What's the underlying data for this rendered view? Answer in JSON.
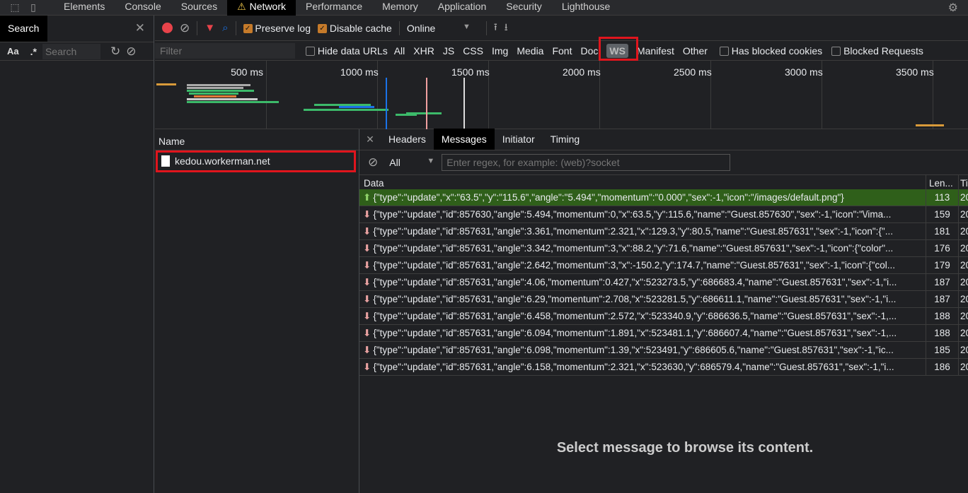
{
  "devtools_tabs": [
    "Elements",
    "Console",
    "Sources",
    "Network",
    "Performance",
    "Memory",
    "Application",
    "Security",
    "Lighthouse"
  ],
  "active_tab": "Network",
  "search_panel": {
    "title": "Search",
    "case_label": "Aa",
    "regex_label": ".*",
    "placeholder": "Search"
  },
  "toolbar": {
    "preserve_log": "Preserve log",
    "disable_cache": "Disable cache",
    "throttle": "Online",
    "preserve_checked": true,
    "disable_checked": true
  },
  "filter": {
    "placeholder": "Filter",
    "hide_data_urls": "Hide data URLs",
    "types": [
      "All",
      "XHR",
      "JS",
      "CSS",
      "Img",
      "Media",
      "Font",
      "Doc",
      "WS",
      "Manifest",
      "Other"
    ],
    "selected_type": "WS",
    "blocked_cookies": "Has blocked cookies",
    "blocked_requests": "Blocked Requests"
  },
  "timeline_ticks": [
    "500 ms",
    "1000 ms",
    "1500 ms",
    "2000 ms",
    "2500 ms",
    "3000 ms",
    "3500 ms"
  ],
  "name_header": "Name",
  "requests": [
    "kedou.workerman.net"
  ],
  "detail_tabs": [
    "Headers",
    "Messages",
    "Initiator",
    "Timing"
  ],
  "active_detail_tab": "Messages",
  "messages_filter": {
    "type": "All",
    "placeholder": "Enter regex, for example: (web)?socket"
  },
  "columns": {
    "data": "Data",
    "length": "Len...",
    "time": "Ti"
  },
  "messages": [
    {
      "dir": "up",
      "data": "{\"type\":\"update\",\"x\":\"63.5\",\"y\":\"115.6\",\"angle\":\"5.494\",\"momentum\":\"0.000\",\"sex\":-1,\"icon\":\"/images/default.png\"}",
      "length": "113",
      "time": "20"
    },
    {
      "dir": "down",
      "data": "{\"type\":\"update\",\"id\":857630,\"angle\":5.494,\"momentum\":0,\"x\":63.5,\"y\":115.6,\"name\":\"Guest.857630\",\"sex\":-1,\"icon\":\"\\/ima...",
      "length": "159",
      "time": "20"
    },
    {
      "dir": "down",
      "data": "{\"type\":\"update\",\"id\":857631,\"angle\":3.361,\"momentum\":2.321,\"x\":129.3,\"y\":80.5,\"name\":\"Guest.857631\",\"sex\":-1,\"icon\":{\"...",
      "length": "181",
      "time": "20"
    },
    {
      "dir": "down",
      "data": "{\"type\":\"update\",\"id\":857631,\"angle\":3.342,\"momentum\":3,\"x\":88.2,\"y\":71.6,\"name\":\"Guest.857631\",\"sex\":-1,\"icon\":{\"color\"...",
      "length": "176",
      "time": "20"
    },
    {
      "dir": "down",
      "data": "{\"type\":\"update\",\"id\":857631,\"angle\":2.642,\"momentum\":3,\"x\":-150.2,\"y\":174.7,\"name\":\"Guest.857631\",\"sex\":-1,\"icon\":{\"col...",
      "length": "179",
      "time": "20"
    },
    {
      "dir": "down",
      "data": "{\"type\":\"update\",\"id\":857631,\"angle\":4.06,\"momentum\":0.427,\"x\":523273.5,\"y\":686683.4,\"name\":\"Guest.857631\",\"sex\":-1,\"i...",
      "length": "187",
      "time": "20"
    },
    {
      "dir": "down",
      "data": "{\"type\":\"update\",\"id\":857631,\"angle\":6.29,\"momentum\":2.708,\"x\":523281.5,\"y\":686611.1,\"name\":\"Guest.857631\",\"sex\":-1,\"i...",
      "length": "187",
      "time": "20"
    },
    {
      "dir": "down",
      "data": "{\"type\":\"update\",\"id\":857631,\"angle\":6.458,\"momentum\":2.572,\"x\":523340.9,\"y\":686636.5,\"name\":\"Guest.857631\",\"sex\":-1,...",
      "length": "188",
      "time": "20"
    },
    {
      "dir": "down",
      "data": "{\"type\":\"update\",\"id\":857631,\"angle\":6.094,\"momentum\":1.891,\"x\":523481.1,\"y\":686607.4,\"name\":\"Guest.857631\",\"sex\":-1,...",
      "length": "188",
      "time": "20"
    },
    {
      "dir": "down",
      "data": "{\"type\":\"update\",\"id\":857631,\"angle\":6.098,\"momentum\":1.39,\"x\":523491,\"y\":686605.6,\"name\":\"Guest.857631\",\"sex\":-1,\"ic...",
      "length": "185",
      "time": "20"
    },
    {
      "dir": "down",
      "data": "{\"type\":\"update\",\"id\":857631,\"angle\":6.158,\"momentum\":2.321,\"x\":523630,\"y\":686579.4,\"name\":\"Guest.857631\",\"sex\":-1,\"i...",
      "length": "186",
      "time": "20"
    }
  ],
  "empty_hint": "Select message to browse its content.",
  "colors": {
    "sent_row": "#2f5f1a",
    "highlight": "#e0151d",
    "record": "#e8434a",
    "checkbox": "#c57a2a"
  }
}
